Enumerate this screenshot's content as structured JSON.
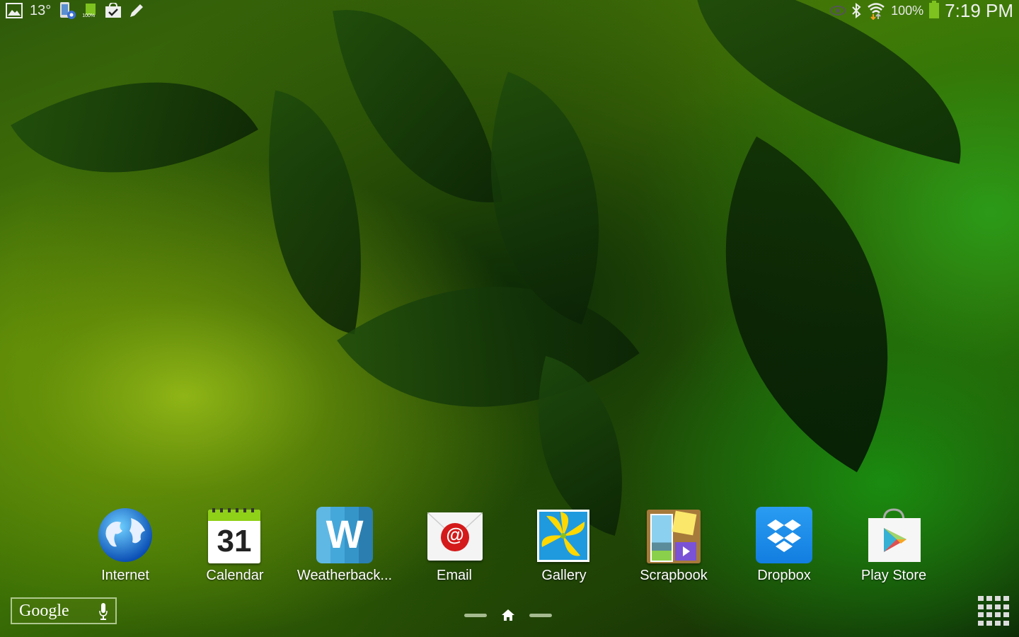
{
  "status_bar": {
    "left_icons": [
      "gallery-notification-icon",
      "temperature",
      "device-settings-icon",
      "battery-100-notification-icon",
      "shopping-bag-check-icon",
      "pencil-icon"
    ],
    "temperature": "13°",
    "battery_small_label": "100%",
    "right_icons": [
      "eye-icon",
      "bluetooth-icon",
      "wifi-icon",
      "battery-icon"
    ],
    "battery_percent": "100%",
    "time": "7:19 PM",
    "battery_color": "#7dc21e"
  },
  "apps": [
    {
      "label": "Internet",
      "icon": "globe-icon"
    },
    {
      "label": "Calendar",
      "icon": "calendar-icon",
      "day": "31"
    },
    {
      "label": "Weatherback...",
      "icon": "weatherbug-icon",
      "glyph": "W"
    },
    {
      "label": "Email",
      "icon": "email-icon",
      "glyph": "@"
    },
    {
      "label": "Gallery",
      "icon": "gallery-icon"
    },
    {
      "label": "Scrapbook",
      "icon": "scrapbook-icon"
    },
    {
      "label": "Dropbox",
      "icon": "dropbox-icon"
    },
    {
      "label": "Play Store",
      "icon": "play-store-icon"
    }
  ],
  "search_widget": {
    "label": "Google",
    "mic_icon": "microphone-icon"
  },
  "pager": {
    "current": "home",
    "pages": 3
  },
  "app_drawer": {
    "icon": "apps-grid-icon"
  }
}
